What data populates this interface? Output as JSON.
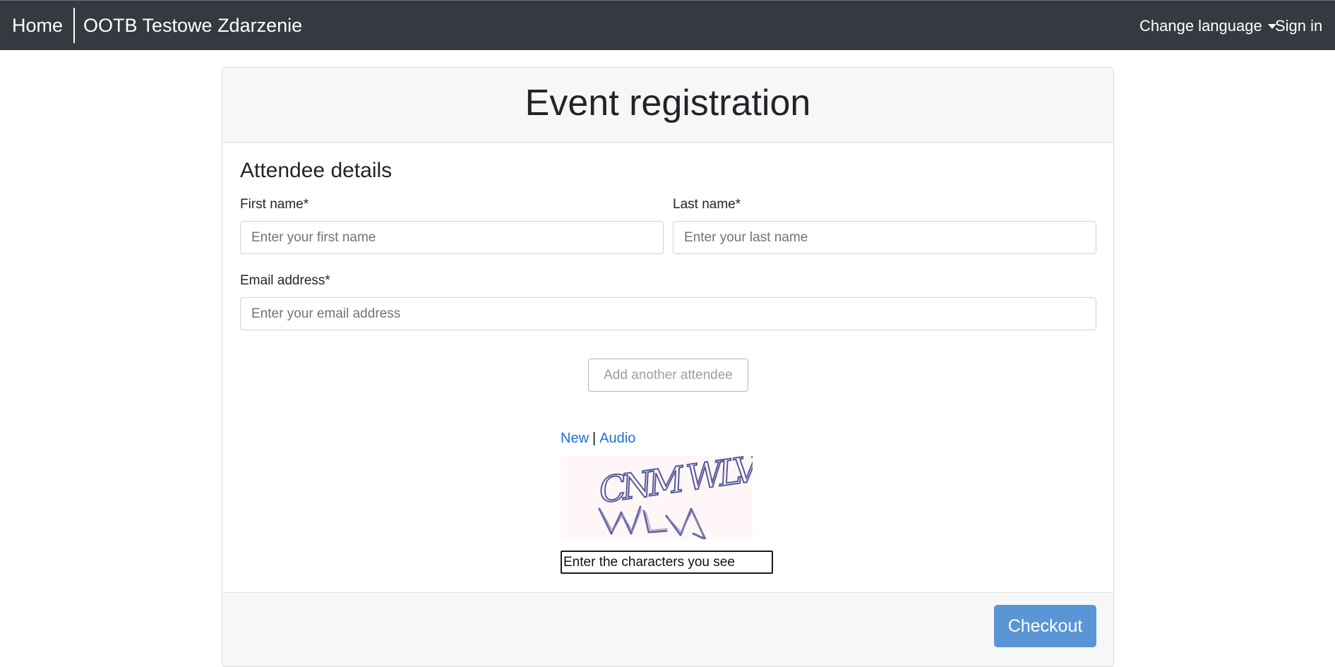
{
  "navbar": {
    "home_label": "Home",
    "event_name": "OOTB Testowe Zdarzenie",
    "change_language_label": "Change language",
    "sign_in_label": "Sign in"
  },
  "page": {
    "title": "Event registration"
  },
  "attendee": {
    "section_title": "Attendee details",
    "first_name": {
      "label": "First name*",
      "placeholder": "Enter your first name",
      "value": ""
    },
    "last_name": {
      "label": "Last name*",
      "placeholder": "Enter your last name",
      "value": ""
    },
    "email": {
      "label": "Email address*",
      "placeholder": "Enter your email address",
      "value": ""
    },
    "add_attendee_label": "Add another attendee"
  },
  "captcha": {
    "new_label": "New",
    "separator": "|",
    "audio_label": "Audio",
    "characters": "CNM WLV",
    "input_placeholder": "Enter the characters you see"
  },
  "footer": {
    "checkout_label": "Checkout"
  },
  "colors": {
    "navbar_bg": "#343a40",
    "link": "#1f6fd8",
    "checkout_bg": "#5a95d5"
  }
}
